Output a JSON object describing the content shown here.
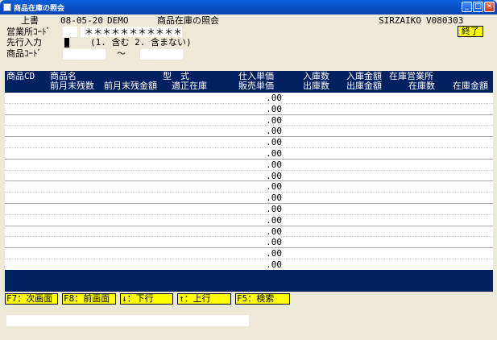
{
  "window": {
    "title": "商品在庫の照会"
  },
  "header": {
    "mode": "上書",
    "date": "08-05-20",
    "company": "DEMO",
    "screen_title": "商品在庫の照会",
    "program_id": "SIRZAIKO",
    "version": "V080303",
    "end_button": "終了",
    "office_code_label": "営業所ｺｰﾄﾞ",
    "office_code_value": "",
    "office_name": "＊＊＊＊＊＊＊＊＊＊＊",
    "advance_label": "先行入力",
    "advance_hint": "(1. 含む 2. 含まない)",
    "product_code_label": "商品ｺｰﾄﾞ",
    "range_sep": "～"
  },
  "table": {
    "headers": {
      "code": "商品CD",
      "name": "商品名",
      "model": "型　式",
      "prev_qty": "前月末残数",
      "prev_amt": "前月末残金額",
      "proper_stock": "適正在庫",
      "purchase_price": "仕入単価",
      "sale_price": "販売単価",
      "in_qty": "入庫数",
      "out_qty": "出庫数",
      "in_amt": "入庫金額",
      "out_amt": "出庫金額",
      "office_stock": "在庫営業所",
      "stock_qty": "在庫数",
      "stock_amt": "在庫金額"
    },
    "rows": [
      {
        "sale_price": ".00"
      },
      {
        "sale_price": ".00"
      },
      {
        "sale_price": ".00"
      },
      {
        "sale_price": ".00"
      },
      {
        "sale_price": ".00"
      },
      {
        "sale_price": ".00"
      },
      {
        "sale_price": ".00"
      },
      {
        "sale_price": ".00"
      }
    ],
    "purchase_prices": [
      ".00",
      ".00",
      ".00",
      ".00",
      ".00",
      ".00",
      ".00",
      ".00"
    ]
  },
  "function_keys": {
    "f7": "F7：次画面",
    "f8": "F8：前画面",
    "down": "↓：下行",
    "up": "↑：上行",
    "f5": "F5：検索"
  },
  "colors": {
    "header_bg": "#002060",
    "fkey_bg": "#ffff00",
    "window_bg": "#ece9d8"
  }
}
